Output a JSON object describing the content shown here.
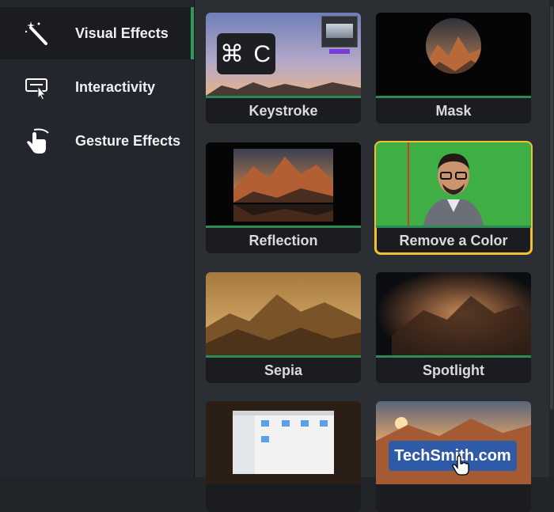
{
  "sidebar": {
    "items": [
      {
        "label": "Visual Effects",
        "icon": "magic-wand-icon",
        "active": true
      },
      {
        "label": "Interactivity",
        "icon": "cursor-click-icon",
        "active": false
      },
      {
        "label": "Gesture Effects",
        "icon": "hand-gesture-icon",
        "active": false
      }
    ]
  },
  "effects": {
    "tiles": [
      {
        "label": "Keystroke"
      },
      {
        "label": "Mask"
      },
      {
        "label": "Reflection"
      },
      {
        "label": "Remove a Color",
        "selected": true
      },
      {
        "label": "Sepia"
      },
      {
        "label": "Spotlight"
      },
      {
        "label": ""
      },
      {
        "label": ""
      }
    ],
    "keystroke_key": "⌘ C",
    "watermark_text": "TechSmith.com"
  },
  "colors": {
    "accent_green": "#2c9a5b",
    "selection_yellow": "#f2c12e",
    "watermark_blue": "#2f5aa8"
  }
}
